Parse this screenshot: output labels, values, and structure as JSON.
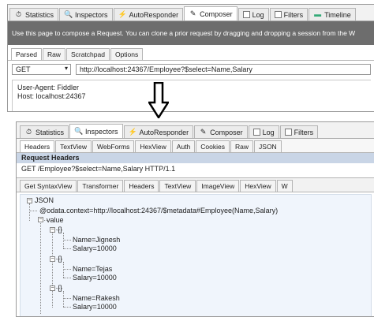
{
  "top_tabs": [
    {
      "label": "Statistics",
      "icon": "stopwatch-icon"
    },
    {
      "label": "Inspectors",
      "icon": "magnifier-icon"
    },
    {
      "label": "AutoResponder",
      "icon": "lightning-icon"
    },
    {
      "label": "Composer",
      "icon": "pencil-icon"
    },
    {
      "label": "Log",
      "icon": "log-checkbox"
    },
    {
      "label": "Filters",
      "icon": "filters-checkbox"
    },
    {
      "label": "Timeline",
      "icon": "timeline-icon"
    }
  ],
  "composer": {
    "hint": "Use this page to compose a Request. You can clone a prior request by dragging and dropping a session from the W",
    "subtabs": [
      "Parsed",
      "Raw",
      "Scratchpad",
      "Options"
    ],
    "method": "GET",
    "url": "http://localhost:24367/Employee?$select=Name,Salary",
    "headers_line1": "User-Agent: Fiddler",
    "headers_line2": "Host: localhost:24367"
  },
  "arrow_icon": "down-arrow-icon",
  "inspector_tabs": [
    {
      "label": "Statistics",
      "icon": "stopwatch-icon"
    },
    {
      "label": "Inspectors",
      "icon": "magnifier-icon"
    },
    {
      "label": "AutoResponder",
      "icon": "lightning-icon"
    },
    {
      "label": "Composer",
      "icon": "pencil-icon"
    },
    {
      "label": "Log",
      "icon": "log-checkbox"
    },
    {
      "label": "Filters",
      "icon": "filters-checkbox"
    }
  ],
  "request_tabs": [
    "Headers",
    "TextView",
    "WebForms",
    "HexView",
    "Auth",
    "Cookies",
    "Raw",
    "JSON"
  ],
  "request_headers": {
    "title": "Request Headers",
    "line": "GET /Employee?$select=Name,Salary HTTP/1.1"
  },
  "response_tabs": [
    "Get SyntaxView",
    "Transformer",
    "Headers",
    "TextView",
    "ImageView",
    "HexView",
    "W"
  ],
  "json_tree": {
    "root": "JSON",
    "context": "@odata.context=http://localhost:24367/$metadata#Employee(Name,Salary)",
    "value": "value",
    "brace": "{}",
    "items": [
      {
        "name": "Name=Jignesh",
        "salary": "Salary=10000"
      },
      {
        "name": "Name=Tejas",
        "salary": "Salary=10000"
      },
      {
        "name": "Name=Rakesh",
        "salary": "Salary=10000"
      }
    ]
  }
}
